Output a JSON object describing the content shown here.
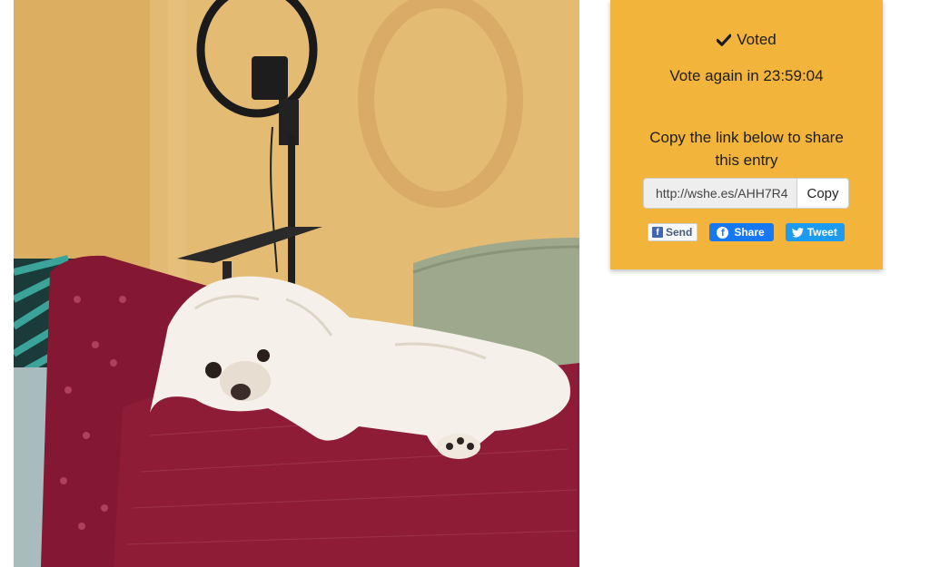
{
  "photo": {
    "subject": "white dog resting on a maroon pillow",
    "colors": {
      "wall": "#e2b86e",
      "pillow": "#8e1b36",
      "couch": "#9aa58a",
      "dog": "#f4f0ea"
    }
  },
  "vote_card": {
    "background": "#f2b43b",
    "status_icon": "check-icon",
    "status_label": "Voted",
    "countdown_text": "Vote again in 23:59:04",
    "share_prompt": "Copy the link below to share this entry",
    "share_link": {
      "value": "http://wshe.es/AHH7R4",
      "copy_label": "Copy"
    },
    "social": {
      "send_label": "Send",
      "share_label": "Share",
      "tweet_label": "Tweet",
      "send_icon": "facebook-square-icon",
      "share_icon": "facebook-circle-icon",
      "tweet_icon": "twitter-bird-icon",
      "colors": {
        "facebook": "#1877f2",
        "twitter": "#1d9bf0"
      }
    }
  }
}
